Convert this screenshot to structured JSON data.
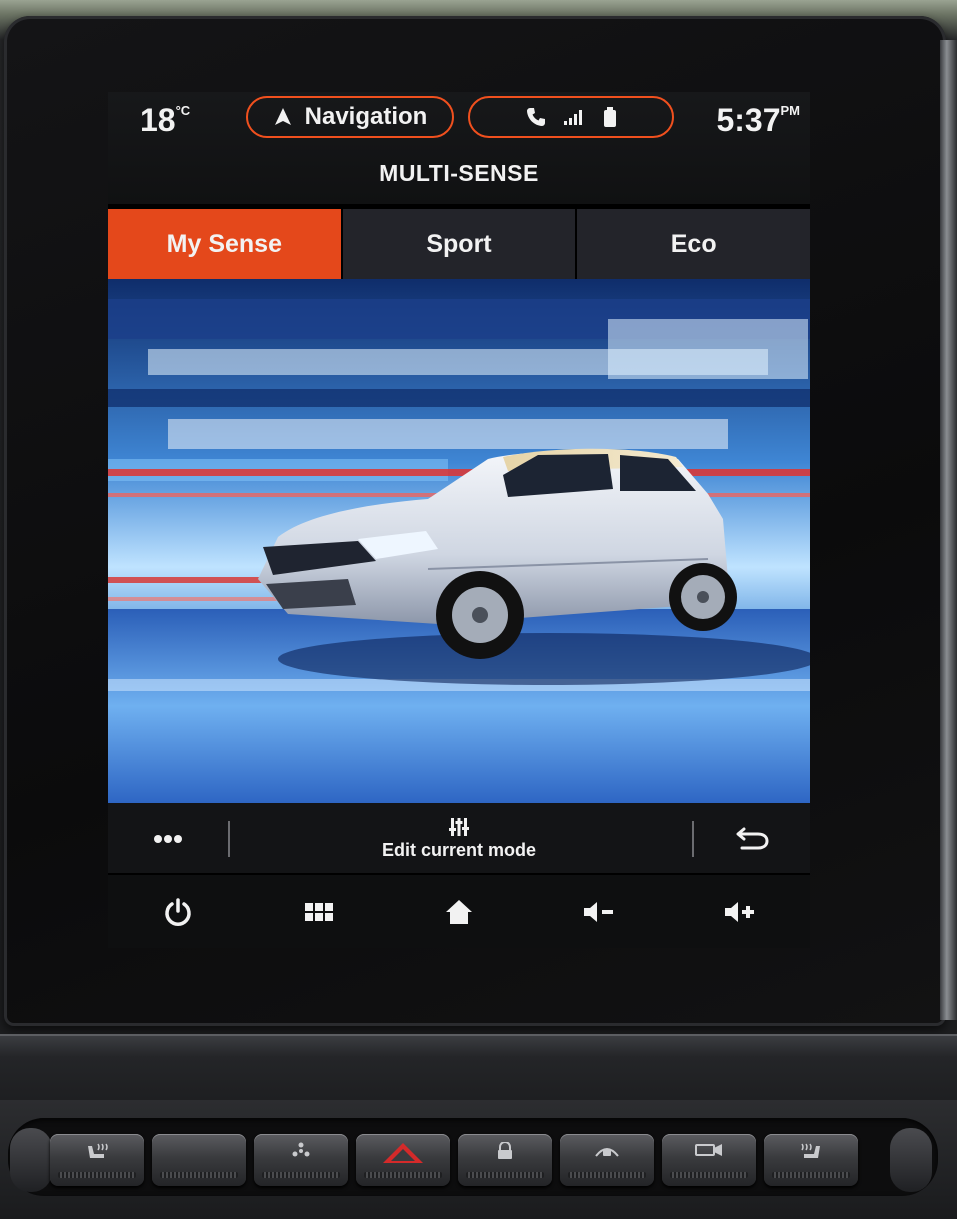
{
  "status_bar": {
    "temperature": "18",
    "temperature_unit": "°C",
    "navigation_label": "Navigation",
    "time": "5:37",
    "time_suffix": "PM"
  },
  "header": {
    "title": "MULTI-SENSE"
  },
  "tabs": [
    {
      "label": "My Sense",
      "active": true
    },
    {
      "label": "Sport",
      "active": false
    },
    {
      "label": "Eco",
      "active": false
    }
  ],
  "action_bar": {
    "more_icon": "more-icon",
    "edit_label": "Edit current mode",
    "edit_icon": "equalizer-icon",
    "back_icon": "back-icon"
  },
  "nav_bar": {
    "items": [
      {
        "icon": "power-icon"
      },
      {
        "icon": "apps-icon"
      },
      {
        "icon": "home-icon"
      },
      {
        "icon": "volume-down-icon"
      },
      {
        "icon": "volume-up-icon"
      }
    ]
  },
  "physical_buttons": [
    {
      "icon": "seat-heat-icon"
    },
    {
      "icon": "blank"
    },
    {
      "icon": "fan-icon"
    },
    {
      "icon": "hazard-icon"
    },
    {
      "icon": "lock-icon"
    },
    {
      "icon": "lane-assist-icon"
    },
    {
      "icon": "camera-icon"
    },
    {
      "icon": "seat-heat-right-icon"
    }
  ],
  "colors": {
    "accent": "#e4481b",
    "pill_border": "#f0501e",
    "text": "#f2f2f2",
    "hazard": "#d42a2a"
  }
}
